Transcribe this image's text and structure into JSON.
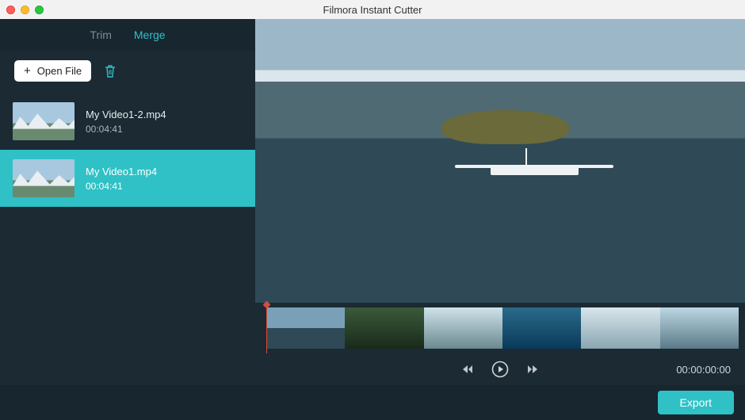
{
  "window": {
    "title": "Filmora Instant Cutter"
  },
  "tabs": {
    "trim": "Trim",
    "merge": "Merge",
    "active": "merge"
  },
  "toolbar": {
    "open_label": "Open File"
  },
  "clips": [
    {
      "name": "My Video1-2.mp4",
      "duration": "00:04:41",
      "selected": false
    },
    {
      "name": "My Video1.mp4",
      "duration": "00:04:41",
      "selected": true
    }
  ],
  "playback": {
    "timecode": "00:00:00:00"
  },
  "footer": {
    "export_label": "Export"
  },
  "colors": {
    "accent": "#2fc1c6",
    "bg": "#1b2a33"
  }
}
